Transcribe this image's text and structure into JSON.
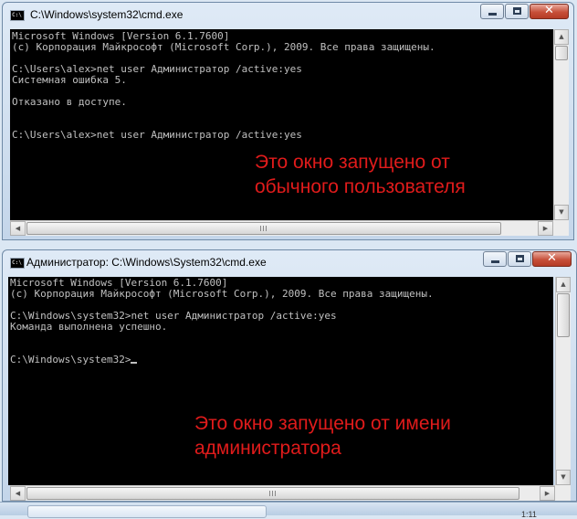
{
  "window_user": {
    "title": "C:\\Windows\\system32\\cmd.exe",
    "icon": "console-app-icon",
    "icon_text": "C:\\",
    "console_lines": [
      "Microsoft Windows [Version 6.1.7600]",
      "(c) Корпорация Майкрософт (Microsoft Corp.), 2009. Все права защищены.",
      "",
      "C:\\Users\\alex>net user Администратор /active:yes",
      "Системная ошибка 5.",
      "",
      "Отказано в доступе.",
      "",
      "",
      "C:\\Users\\alex>net user Администратор /active:yes"
    ],
    "caption_lines": [
      "Это окно запущено от",
      "обычного пользователя"
    ]
  },
  "window_admin": {
    "title": "Администратор: C:\\Windows\\System32\\cmd.exe",
    "icon": "console-app-icon",
    "icon_text": "C:\\",
    "console_lines": [
      "Microsoft Windows [Version 6.1.7600]",
      "(c) Корпорация Майкрософт (Microsoft Corp.), 2009. Все права защищены.",
      "",
      "C:\\Windows\\system32>net user Администратор /active:yes",
      "Команда выполнена успешно.",
      "",
      "",
      "C:\\Windows\\system32>"
    ],
    "caption_lines": [
      "Это окно запущено от имени",
      "администратора"
    ]
  },
  "window_controls": {
    "minimize": "minimize-icon",
    "maximize": "maximize-icon",
    "close": "close-icon",
    "close_glyph": "✕"
  },
  "scrollbar_glyphs": {
    "up": "▲",
    "down": "▼",
    "left": "◀",
    "right": "▶"
  },
  "taskbar": {
    "clock": "1:11"
  },
  "colors": {
    "console_bg": "#000000",
    "console_text": "#c0c0c0",
    "caption_text": "#e01b1b",
    "close_button": "#c7503a"
  }
}
